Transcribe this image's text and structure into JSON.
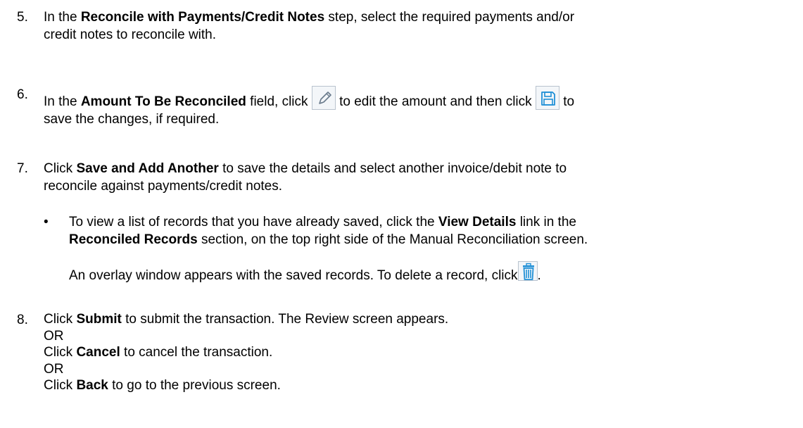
{
  "step5": {
    "number": "5.",
    "pre": "In the ",
    "bold": "Reconcile with Payments/Credit Notes",
    "post": " step, select the required payments and/or",
    "line2": "credit notes to reconcile with."
  },
  "step6": {
    "number": "6.",
    "pre": "In the ",
    "bold": "Amount To Be Reconciled",
    "mid1": " field, click ",
    "mid2": " to edit the amount and then click ",
    "post": " to",
    "line2": "save the changes, if required.",
    "edit_icon": "pencil-edit-icon",
    "save_icon": "floppy-save-icon"
  },
  "step7": {
    "number": "7.",
    "pre": "Click ",
    "bold": "Save and Add Another",
    "post": " to save the details and select another invoice/debit note to",
    "line2": "reconcile against payments/credit notes.",
    "bullet": {
      "symbol": "•",
      "pre": "To view a list of records that you have already saved, click the ",
      "bold1": "View Details",
      "post1": " link in the",
      "bold2": "Reconciled Records",
      "post2": " section, on the top right side of the Manual Reconciliation screen.",
      "overlay_text": "An overlay window appears with the saved records. To delete a record, click",
      "overlay_end": ".",
      "delete_icon": "trash-delete-icon"
    }
  },
  "step8": {
    "number": "8.",
    "line1_pre": "Click ",
    "line1_bold": "Submit",
    "line1_post": " to submit the transaction. The Review screen appears.",
    "or1": "OR",
    "line2_pre": "Click ",
    "line2_bold": "Cancel",
    "line2_post": " to cancel the transaction.",
    "or2": "OR",
    "line3_pre": "Click ",
    "line3_bold": "Back",
    "line3_post": " to go to the previous screen."
  },
  "colors": {
    "text": "#000000",
    "icon_border": "#b9c3ce",
    "icon_bg": "#f3f6f9",
    "icon_blue": "#1f8fd6"
  }
}
